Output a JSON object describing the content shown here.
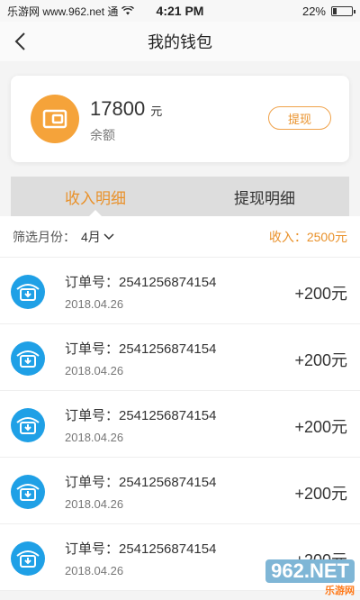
{
  "status_bar": {
    "carrier": "乐游网 www.962.net 通",
    "time": "4:21 PM",
    "battery": "22%",
    "battery_level": 0.22
  },
  "nav": {
    "title": "我的钱包"
  },
  "balance": {
    "amount": "17800",
    "unit": "元",
    "label": "余额",
    "withdraw_label": "提现"
  },
  "tabs": [
    {
      "label": "收入明细",
      "active": true
    },
    {
      "label": "提现明细",
      "active": false
    }
  ],
  "filter": {
    "label": "筛选月份：",
    "month": "4月",
    "income_summary": "收入：2500元"
  },
  "transactions": [
    {
      "order": "订单号：2541256874154",
      "date": "2018.04.26",
      "amount": "+200元"
    },
    {
      "order": "订单号：2541256874154",
      "date": "2018.04.26",
      "amount": "+200元"
    },
    {
      "order": "订单号：2541256874154",
      "date": "2018.04.26",
      "amount": "+200元"
    },
    {
      "order": "订单号：2541256874154",
      "date": "2018.04.26",
      "amount": "+200元"
    },
    {
      "order": "订单号：2541256874154",
      "date": "2018.04.26",
      "amount": "+200元"
    }
  ],
  "colors": {
    "accent": "#e9912a",
    "wallet_icon": "#f5a33a",
    "transaction_icon": "#1fa0e6"
  },
  "watermark": {
    "logo": "962.NET",
    "subtitle": "乐游网"
  }
}
